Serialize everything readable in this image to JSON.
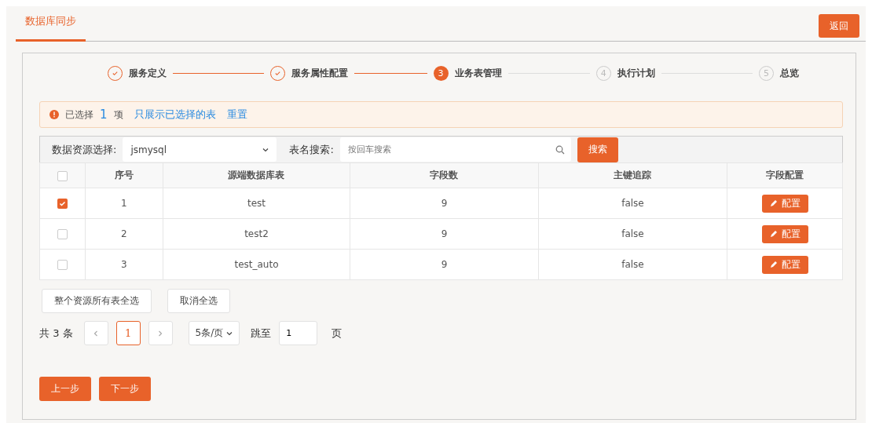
{
  "header": {
    "tabs": [
      {
        "label": "数据库同步",
        "selected": true
      }
    ],
    "back_button": "返回"
  },
  "steps": [
    {
      "label": "服务定义",
      "completed": true,
      "selected": false
    },
    {
      "label": "服务属性配置",
      "completed": true,
      "selected": false
    },
    {
      "number": "3",
      "label": "业务表管理",
      "completed": false,
      "selected": true
    },
    {
      "number": "4",
      "label": "执行计划",
      "completed": false,
      "selected": false
    },
    {
      "number": "5",
      "label": "总览",
      "completed": false,
      "selected": false
    }
  ],
  "alert": {
    "prefix": "已选择",
    "count": "1",
    "suffix": "项",
    "links": [
      "只展示已选择的表",
      "重置"
    ]
  },
  "filter": {
    "source_label": "数据资源选择:",
    "source_value": "jsmysql",
    "search_label": "表名搜索:",
    "search_placeholder": "按回车搜索",
    "search_button": "搜索"
  },
  "table": {
    "all_checked": false,
    "columns": [
      "序号",
      "源端数据库表",
      "字段数",
      "主键追踪",
      "字段配置"
    ],
    "rows": [
      {
        "checked": true,
        "index": "1",
        "table": "test",
        "fields": "9",
        "pk": "false",
        "action": "配置"
      },
      {
        "checked": false,
        "index": "2",
        "table": "test2",
        "fields": "9",
        "pk": "false",
        "action": "配置"
      },
      {
        "checked": false,
        "index": "3",
        "table": "test_auto",
        "fields": "9",
        "pk": "false",
        "action": "配置"
      }
    ]
  },
  "bulk_buttons": [
    "整个资源所有表全选",
    "取消全选"
  ],
  "pagination": {
    "total": "共 3 条",
    "pages": [
      {
        "label": "1",
        "selected": true
      }
    ],
    "page_size": "5条/页",
    "jump_label": "跳至",
    "jump_value": "1",
    "page_unit": "页"
  },
  "footer_buttons": [
    "上一步",
    "下一步"
  ]
}
